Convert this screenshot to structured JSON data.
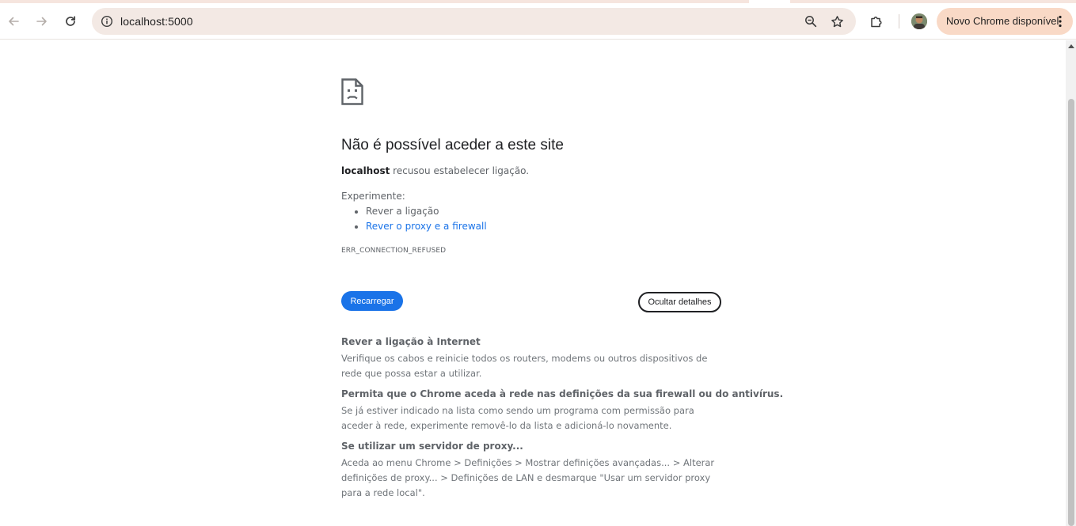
{
  "browser": {
    "url": "localhost:5000",
    "update_chip_label": "Novo Chrome disponível",
    "icons": {
      "back": "back-arrow-icon",
      "forward": "forward-arrow-icon",
      "reload": "reload-icon",
      "site_info": "site-info-icon",
      "zoom": "zoom-icon",
      "bookmark": "bookmark-star-icon",
      "extensions": "extensions-puzzle-icon",
      "profile": "profile-avatar",
      "menu": "three-dots-menu-icon"
    },
    "colors": {
      "omnibox_bg": "#f3e9e4",
      "chip_bg": "#f9d9c6"
    }
  },
  "error_page": {
    "icon": "sad-page-icon",
    "title": "Não é possível aceder a este site",
    "host": "localhost",
    "description_suffix": " recusou estabelecer ligação.",
    "try_label": "Experimente:",
    "suggestions": [
      {
        "label": "Rever a ligação",
        "is_link": false
      },
      {
        "label": "Rever o proxy e a firewall",
        "is_link": true
      }
    ],
    "error_code": "ERR_CONNECTION_REFUSED",
    "reload_button": "Recarregar",
    "details_button": "Ocultar detalhes",
    "details": [
      {
        "heading": "Rever a ligação à Internet",
        "body": "Verifique os cabos e reinicie todos os routers, modems ou outros dispositivos de rede que possa estar a utilizar."
      },
      {
        "heading": "Permita que o Chrome aceda à rede nas definições da sua firewall ou do antivírus.",
        "body": "Se já estiver indicado na lista como sendo um programa com permissão para aceder à rede, experimente removê-lo da lista e adicioná-lo novamente."
      },
      {
        "heading": "Se utilizar um servidor de proxy...",
        "body": "Aceda ao menu Chrome > Definições > Mostrar definições avançadas... > Alterar definições de proxy... > Definições de LAN e desmarque \"Usar um servidor proxy para a rede local\"."
      }
    ],
    "colors": {
      "accent": "#1a73e8",
      "link": "#1a73e8",
      "text_primary": "#202124",
      "text_secondary": "#5f6368"
    }
  }
}
